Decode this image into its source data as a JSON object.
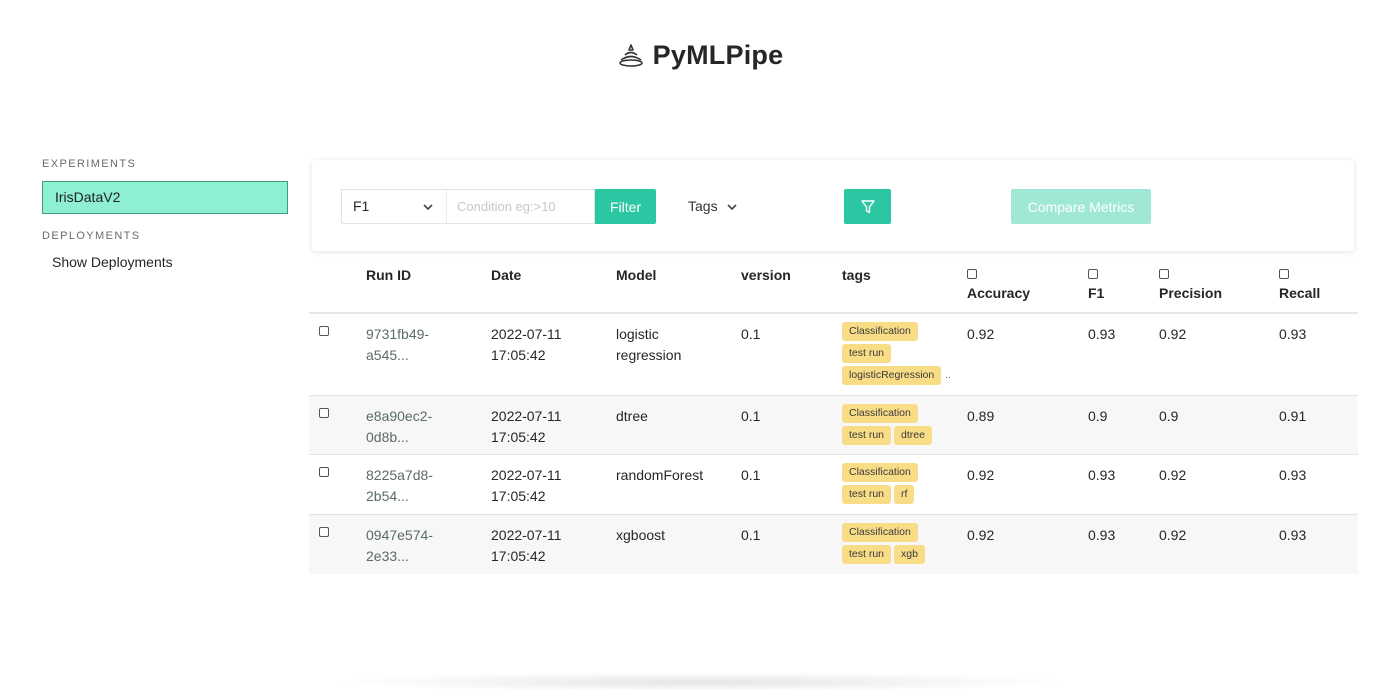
{
  "app": {
    "title": "PyMLPipe"
  },
  "sidebar": {
    "experiments_label": "EXPERIMENTS",
    "experiments": [
      {
        "label": "IrisDataV2",
        "selected": true
      }
    ],
    "deployments_label": "DEPLOYMENTS",
    "show_deployments_label": "Show Deployments"
  },
  "filter": {
    "metric_selected": "F1",
    "condition_placeholder": "Condition eg:>10",
    "filter_button": "Filter",
    "tags_label": "Tags",
    "compare_button": "Compare Metrics"
  },
  "colors": {
    "accent": "#2bc7a3",
    "selected_bg": "#8eefd3",
    "tag_bg": "#f8dd86"
  },
  "table": {
    "headers": {
      "run_id": "Run ID",
      "date": "Date",
      "model": "Model",
      "version": "version",
      "tags": "tags",
      "accuracy": "Accuracy",
      "f1": "F1",
      "precision": "Precision",
      "recall": "Recall"
    },
    "rows": [
      {
        "run_id_1": "9731fb49-",
        "run_id_2": "a545...",
        "date": "2022-07-11",
        "time": "17:05:42",
        "model_1": "logistic",
        "model_2": "regression",
        "version": "0.1",
        "tags": [
          "Classification",
          "test run",
          "logisticRegression"
        ],
        "accuracy": "0.92",
        "f1": "0.93",
        "precision": "0.92",
        "recall": "0.93"
      },
      {
        "run_id_1": "e8a90ec2-",
        "run_id_2": "0d8b...",
        "date": "2022-07-11",
        "time": "17:05:42",
        "model_1": "dtree",
        "model_2": "",
        "version": "0.1",
        "tags": [
          "Classification",
          "test run",
          "dtree"
        ],
        "accuracy": "0.89",
        "f1": "0.9",
        "precision": "0.9",
        "recall": "0.91"
      },
      {
        "run_id_1": "8225a7d8-",
        "run_id_2": "2b54...",
        "date": "2022-07-11",
        "time": "17:05:42",
        "model_1": "randomForest",
        "model_2": "",
        "version": "0.1",
        "tags": [
          "Classification",
          "test run",
          "rf"
        ],
        "accuracy": "0.92",
        "f1": "0.93",
        "precision": "0.92",
        "recall": "0.93"
      },
      {
        "run_id_1": "0947e574-",
        "run_id_2": "2e33...",
        "date": "2022-07-11",
        "time": "17:05:42",
        "model_1": "xgboost",
        "model_2": "",
        "version": "0.1",
        "tags": [
          "Classification",
          "test run",
          "xgb"
        ],
        "accuracy": "0.92",
        "f1": "0.93",
        "precision": "0.92",
        "recall": "0.93"
      }
    ]
  }
}
